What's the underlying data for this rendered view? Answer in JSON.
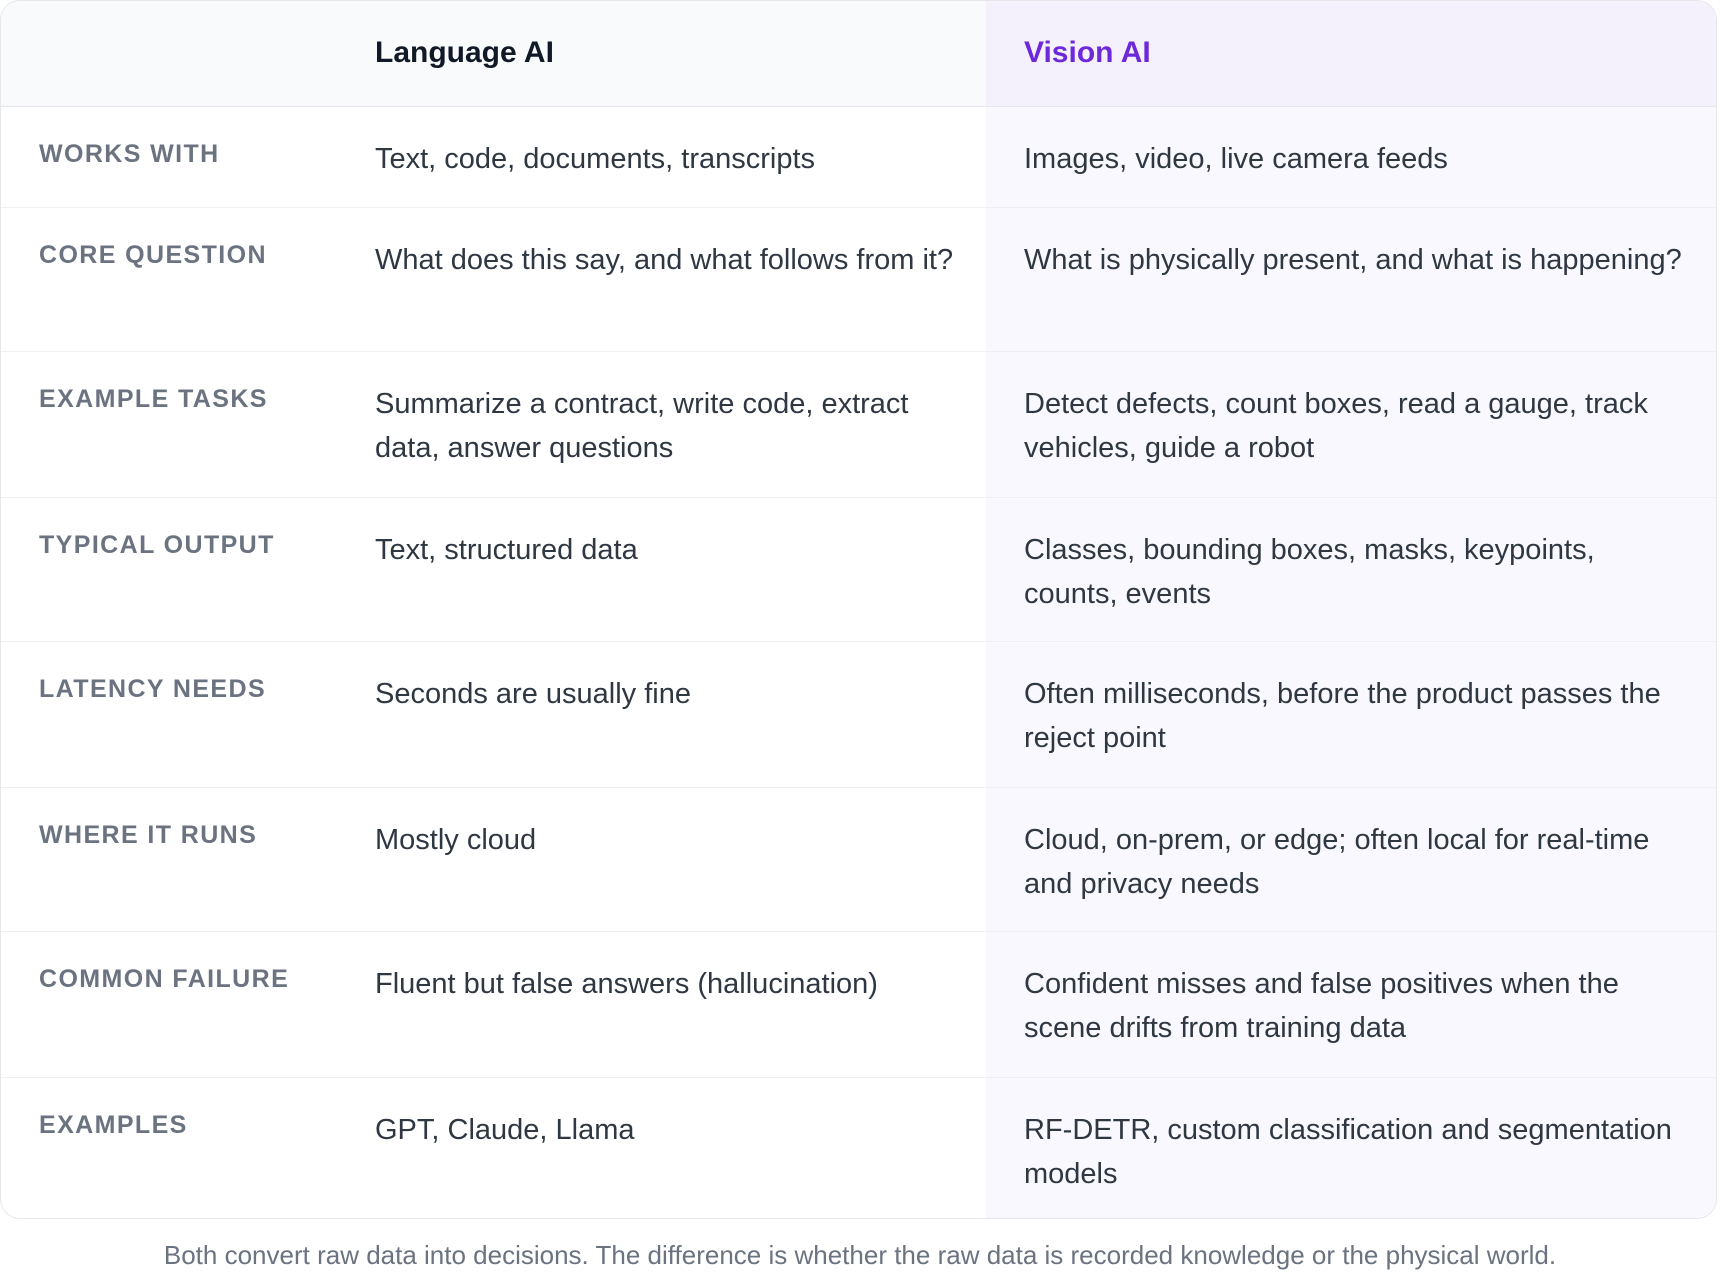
{
  "header": {
    "language": "Language AI",
    "vision": "Vision AI"
  },
  "rows": [
    {
      "label": "WORKS WITH",
      "language": "Text, code, documents, transcripts",
      "vision": "Images, video, live camera feeds"
    },
    {
      "label": "CORE QUESTION",
      "language": "What does this say, and what follows from it?",
      "vision": "What is physically present, and what is happening?"
    },
    {
      "label": "EXAMPLE TASKS",
      "language": "Summarize a contract, write code, extract data, answer questions",
      "vision": "Detect defects, count boxes, read a gauge, track vehicles, guide a robot"
    },
    {
      "label": "TYPICAL OUTPUT",
      "language": "Text, structured data",
      "vision": "Classes, bounding boxes, masks, keypoints, counts, events"
    },
    {
      "label": "LATENCY NEEDS",
      "language": "Seconds are usually fine",
      "vision": "Often milliseconds, before the product passes the reject point"
    },
    {
      "label": "WHERE IT RUNS",
      "language": "Mostly cloud",
      "vision": "Cloud, on-prem, or edge; often local for real-time and privacy needs"
    },
    {
      "label": "COMMON FAILURE",
      "language": "Fluent but false answers (hallucination)",
      "vision": "Confident misses and false positives when the scene drifts from training data"
    },
    {
      "label": "EXAMPLES",
      "language": "GPT, Claude, Llama",
      "vision": "RF-DETR, custom classification and segmentation models"
    }
  ],
  "footer": "Both convert raw data into decisions. The difference is whether the raw data is recorded knowledge or the physical world.",
  "colors": {
    "vision_accent": "#6d28d9",
    "label_gray": "#6b7280",
    "vision_column_bg": "#f9f8fe"
  }
}
